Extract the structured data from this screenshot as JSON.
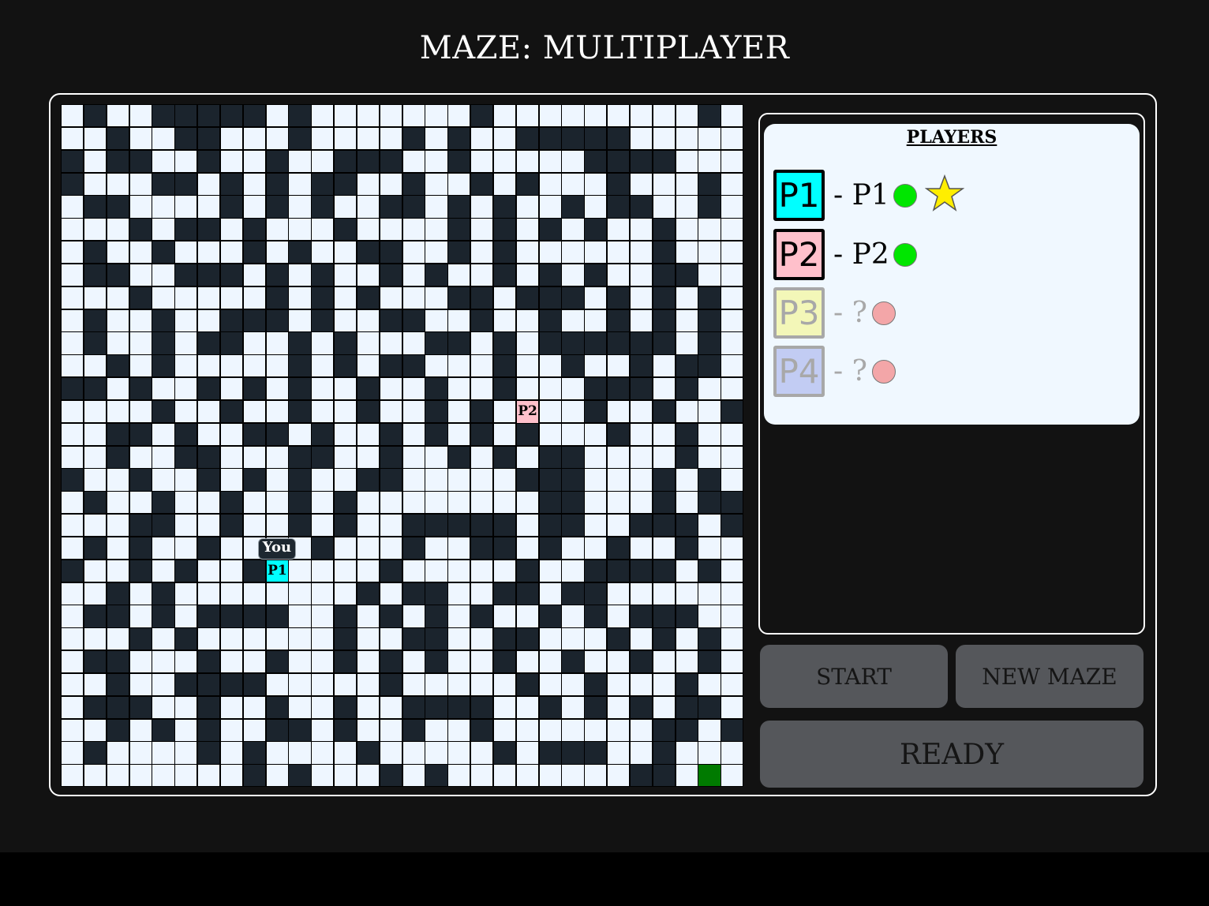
{
  "title": "MAZE: MULTIPLAYER",
  "colors": {
    "wall": "#1b242d",
    "path": "#eef6ff",
    "goal": "#007a00",
    "online": "#00e600",
    "offline": "#f3a6a8"
  },
  "maze": {
    "rows": 30,
    "cols": 30,
    "legend": "# = wall, . = open, G = goal",
    "grid": [
      ".#..#####.#.......#.........#.",
      "..#..##...#....#.#..#####.....",
      "#.##..#..#..###..#.....####...",
      "#...##.#.#.##..#..#.#...#...#.",
      ".##....#.#.#..##.#.#..#.##..#.",
      "...#.##.#...#....#.#.#.#..#...",
      ".#..#...#.#..##..#.#......#...",
      ".##..###.#.#..#.#..#.#.#..##..",
      "...#.....#.#.#...##.###.#.#.#.",
      ".#..#..###.#..##..#..#..#.#.#.",
      ".#..#.##..#.#...##.#.######.#.",
      "..#.#.....#.#.##...#..#..#.##.",
      "##.#..#.#.#..#..#..#...###.#..",
      "....#..#..#..#..#.#.#..#..#..#",
      "..##.#..##.#..#.#.#.#...#..#..",
      "..#..##...##..#..#.#.##....#..",
      "#..#..#.#.#..##.....###...#.#.",
      ".#..#..#..#.#........##...#.##",
      "...##..#..#.#..#####.##..###.#",
      ".#.#..#....#...#..##.#..#..#..",
      "#..#.#..#.....#.....#..####.#.",
      "..#.#........#.##..##.##......",
      ".##.#.####..#.#.#.#..#.#.###..",
      "...#.#......#..##..##...#.#.#.",
      ".##...#..#..#.#.#..#..#..#..#.",
      "..#..####.....#.....#..#...#..",
      ".###..#..#..#..####..#.#.#.##.",
      "..#.#.#..##.#..#..#.......##.#",
      ".#....#.#....#.....#.###..#...",
      "........#.#...#.#........##.G."
    ]
  },
  "board_players": [
    {
      "label": "P1",
      "row": 20,
      "col": 9,
      "color": "#00ffff",
      "you_label": "You"
    },
    {
      "label": "P2",
      "row": 13,
      "col": 20,
      "color": "#ffc0cb"
    }
  ],
  "players_panel": {
    "heading": "PLAYERS",
    "players": [
      {
        "badge": "P1",
        "name": "- P1",
        "color": "#00ffff",
        "status": "online",
        "host": true
      },
      {
        "badge": "P2",
        "name": "- P2",
        "color": "#ffc0cb",
        "status": "online",
        "host": false
      },
      {
        "badge": "P3",
        "name": "- ?",
        "color": "#f3f7b8",
        "status": "offline",
        "host": false
      },
      {
        "badge": "P4",
        "name": "- ?",
        "color": "#c2ccf3",
        "status": "offline",
        "host": false
      }
    ]
  },
  "buttons": {
    "start": "START",
    "new_maze": "NEW MAZE",
    "ready": "READY"
  }
}
